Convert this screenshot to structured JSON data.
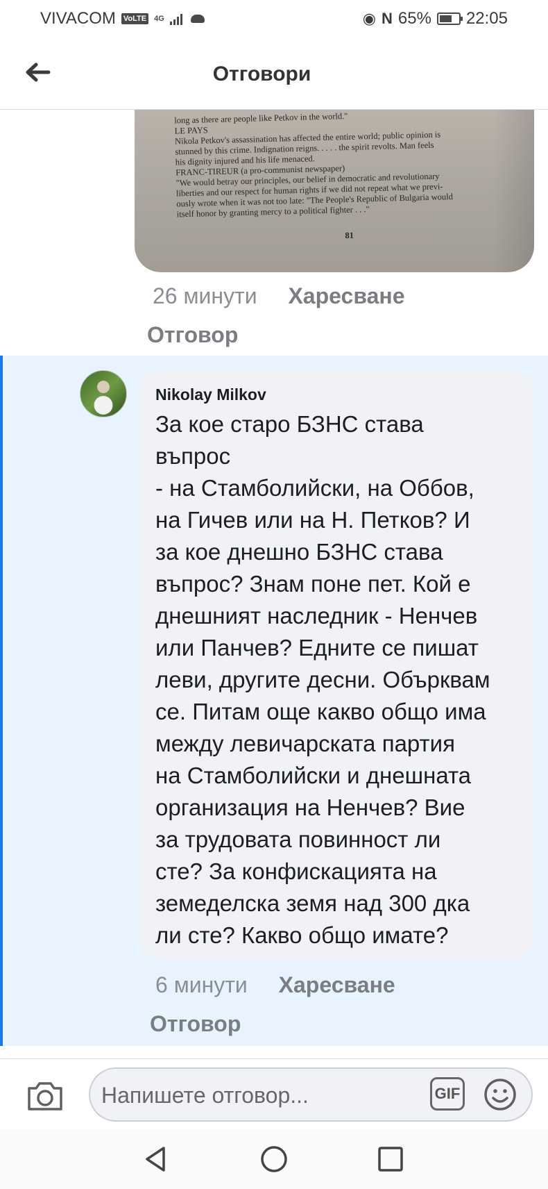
{
  "status_bar": {
    "carrier": "VIVACOM",
    "volte": "VoLTE",
    "network": "4G",
    "battery": "65%",
    "battery_level": 0.65,
    "time": "22:05"
  },
  "header": {
    "title": "Отговори",
    "back_icon": "arrow-left-icon"
  },
  "photo": {
    "lines": [
      "long as there are people like Petkov in the world.\"",
      "LE PAYS",
      "  Nikola Petkov's assassination has affected the entire world; public opinion is",
      "stunned by this crime.  Indignation reigns. . . . . the spirit revolts.  Man feels",
      "his dignity injured and his life menaced.",
      "FRANC-TIREUR (a pro-communist newspaper)",
      "  \"We would betray our principles, our belief in democratic and revolutionary",
      "liberties and our respect for human rights if we did not repeat what we previ-",
      "ously wrote when it was not too late: \"The People's Republic of Bulgaria would",
      "itself honor by granting mercy to a political fighter . . .\""
    ],
    "page_number": "81"
  },
  "previous_comment_meta": {
    "time": "26 минути",
    "like": "Харесване",
    "reply": "Отговор"
  },
  "comment": {
    "author": "Nikolay Milkov",
    "text": "За кое старо БЗНС става\nвъпрос\n- на Стамболийски, на Оббов,\nна Гичев или на Н. Петков? И\nза кое днешно БЗНС става\nвъпрос? Знам поне пет. Кой е\nднешният наследник - Ненчев\nили Панчев? Едните се пишат\nлеви, другите десни. Обърквам\nсе. Питам още какво общо има\nмежду левичарската партия\nна Стамболийски и днешната\nорганизация на Ненчев? Вие\nза трудовата повинност ли\nсте? За конфискацията на\nземеделска земя над 300 дка\nли сте? Какво общо имате?",
    "time": "6 минути",
    "like": "Харесване",
    "reply": "Отговор"
  },
  "composer": {
    "placeholder": "Напишете отговор...",
    "gif_label": "GIF",
    "camera_icon": "camera-icon",
    "emoji_icon": "smiley-icon"
  },
  "nav_bar": {
    "back": "triangle-back-icon",
    "home": "circle-home-icon",
    "recents": "square-recents-icon"
  },
  "colors": {
    "highlight_bg": "#e7f3ff",
    "highlight_border": "#1877f2",
    "bubble_bg": "#f0f2f5"
  }
}
